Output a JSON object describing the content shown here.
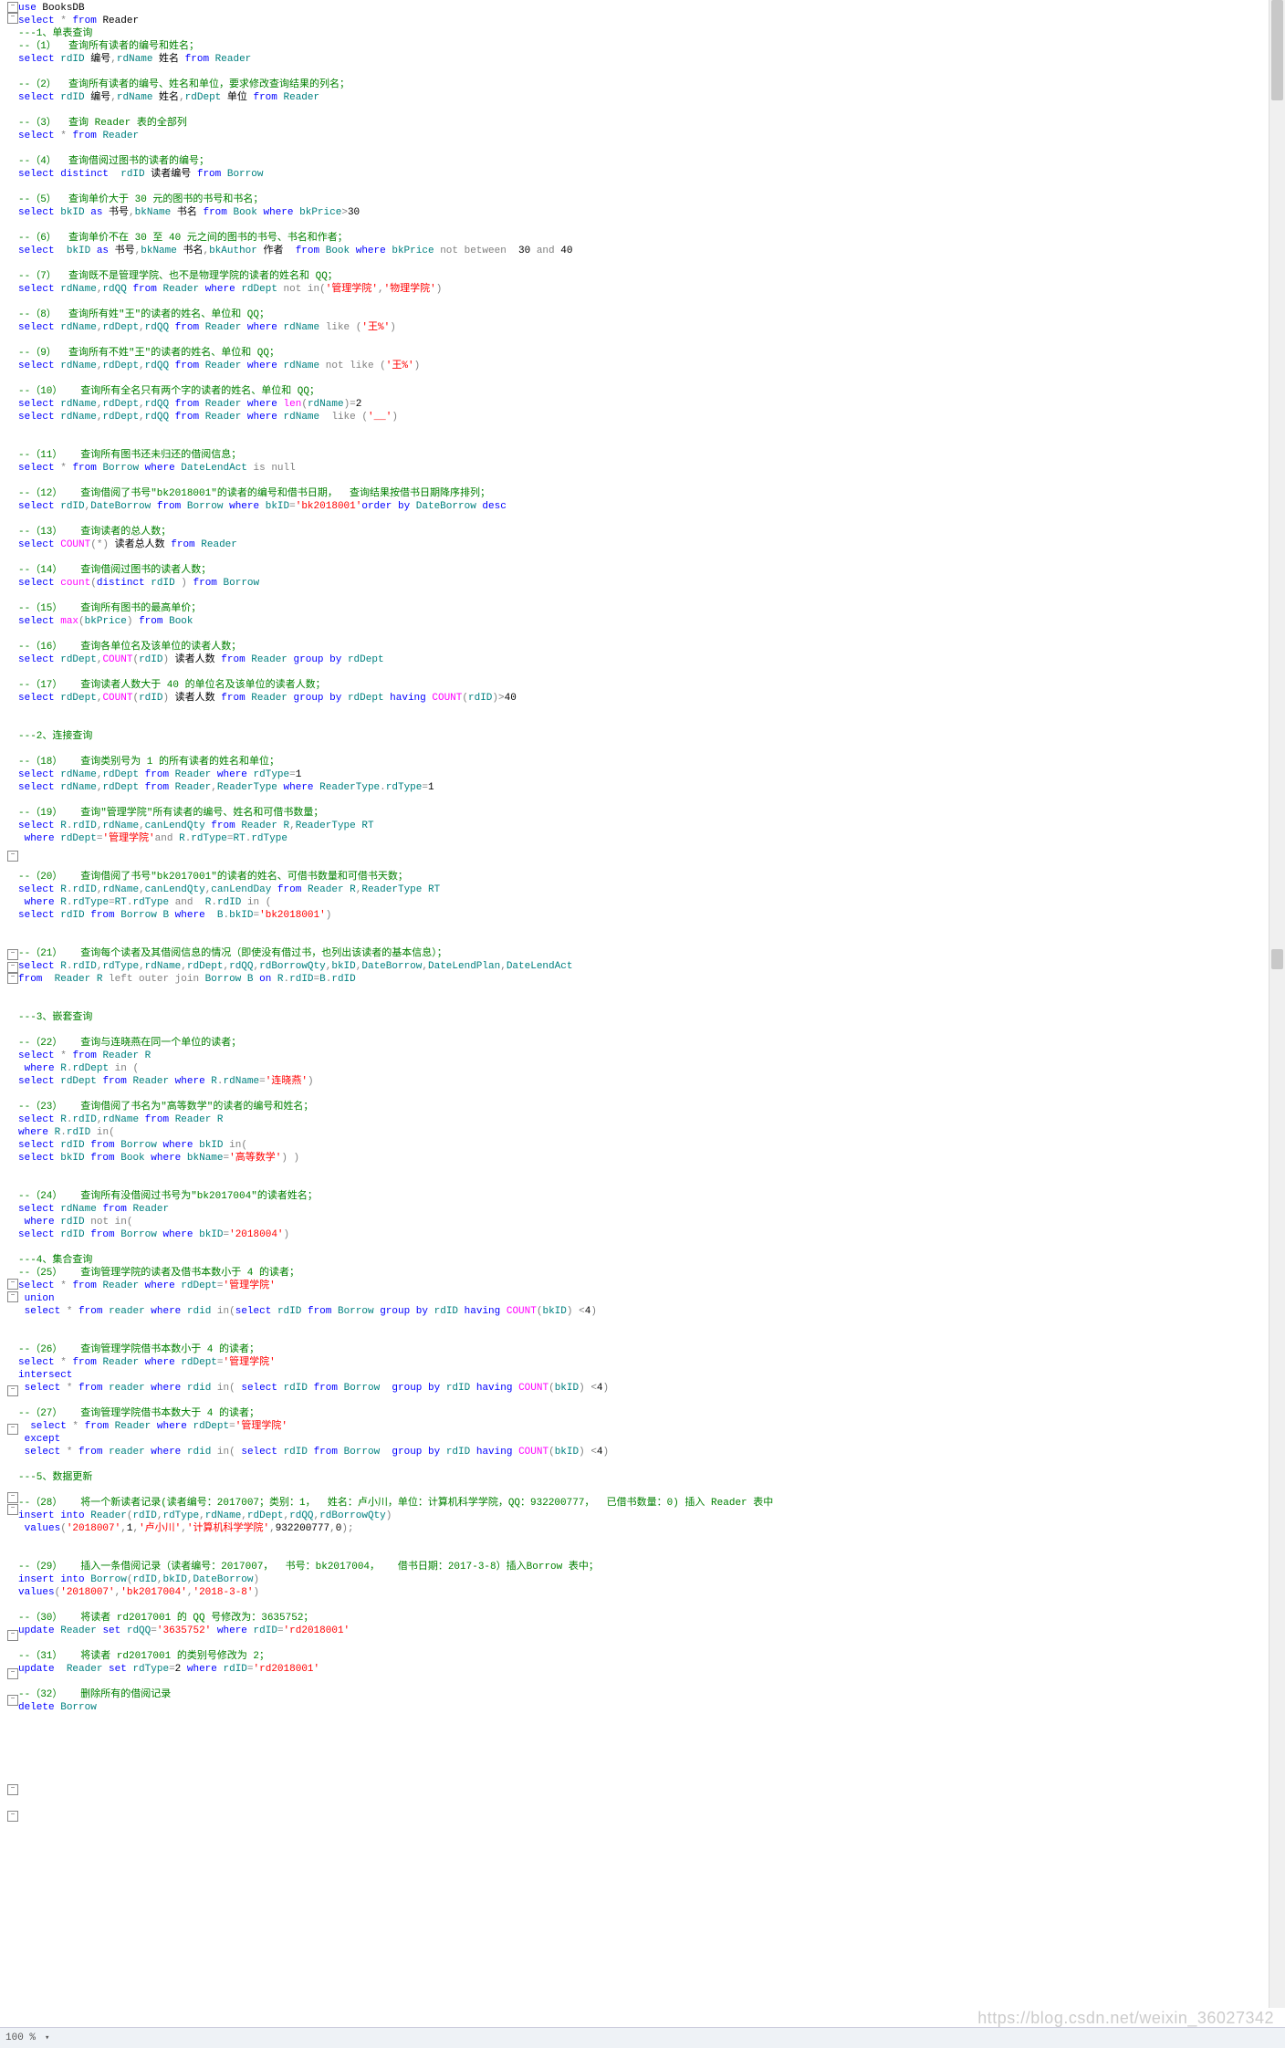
{
  "status": {
    "zoom": "100 %",
    "dd": "▾"
  },
  "watermark": "https://blog.csdn.net/weixin_36027342",
  "folds": [
    2,
    14,
    932,
    1040,
    1054,
    1066,
    1401,
    1415,
    1518,
    1560,
    1635,
    1648,
    1786,
    1828,
    1857,
    1955,
    1984
  ],
  "lines": [
    "<span class='kw'>use</span> BooksDB",
    "<span class='kw'>select</span> <span class='op'>*</span> <span class='kw'>from</span> Reader",
    "<span class='cm'>---1、单表查询</span>",
    "<span class='cm'>--（1）  查询所有读者的编号和姓名；</span>",
    "<span class='kw'>select</span> <span class='id'>rdID</span> 编号<span class='op'>,</span><span class='id'>rdName</span> 姓名 <span class='kw'>from</span> <span class='id'>Reader</span>",
    "",
    "<span class='cm'>--（2）  查询所有读者的编号、姓名和单位，要求修改查询结果的列名；</span>",
    "<span class='kw'>select</span> <span class='id'>rdID</span> 编号<span class='op'>,</span><span class='id'>rdName</span> 姓名<span class='op'>,</span><span class='id'>rdDept</span> 单位 <span class='kw'>from</span> <span class='id'>Reader</span>",
    "",
    "<span class='cm'>--（3）  查询 Reader 表的全部列</span>",
    "<span class='kw'>select</span> <span class='op'>*</span> <span class='kw'>from</span> <span class='id'>Reader</span>",
    "",
    "<span class='cm'>--（4）  查询借阅过图书的读者的编号；</span>",
    "<span class='kw'>select</span> <span class='kw'>distinct</span>  <span class='id'>rdID</span> 读者编号 <span class='kw'>from</span> <span class='id'>Borrow</span>",
    "",
    "<span class='cm'>--（5）  查询单价大于 30 元的图书的书号和书名；</span>",
    "<span class='kw'>select</span> <span class='id'>bkID</span> <span class='kw'>as</span> 书号<span class='op'>,</span><span class='id'>bkName</span> 书名 <span class='kw'>from</span> <span class='id'>Book</span> <span class='kw'>where</span> <span class='id'>bkPrice</span><span class='op'>&gt;</span>30",
    "",
    "<span class='cm'>--（6）  查询单价不在 30 至 40 元之间的图书的书号、书名和作者；</span>",
    "<span class='kw'>select</span>  <span class='id'>bkID</span> <span class='kw'>as</span> 书号<span class='op'>,</span><span class='id'>bkName</span> 书名<span class='op'>,</span><span class='id'>bkAuthor</span> 作者  <span class='kw'>from</span> <span class='id'>Book</span> <span class='kw'>where</span> <span class='id'>bkPrice</span> <span class='gy'>not between</span>  30 <span class='gy'>and</span> 40",
    "",
    "<span class='cm'>--（7）  查询既不是管理学院、也不是物理学院的读者的姓名和 QQ；</span>",
    "<span class='kw'>select</span> <span class='id'>rdName</span><span class='op'>,</span><span class='id'>rdQQ</span> <span class='kw'>from</span> <span class='id'>Reader</span> <span class='kw'>where</span> <span class='id'>rdDept</span> <span class='gy'>not in</span><span class='op'>(</span><span class='str'>'管理学院'</span><span class='op'>,</span><span class='str'>'物理学院'</span><span class='op'>)</span>",
    "",
    "<span class='cm'>--（8）  查询所有姓\"王\"的读者的姓名、单位和 QQ；</span>",
    "<span class='kw'>select</span> <span class='id'>rdName</span><span class='op'>,</span><span class='id'>rdDept</span><span class='op'>,</span><span class='id'>rdQQ</span> <span class='kw'>from</span> <span class='id'>Reader</span> <span class='kw'>where</span> <span class='id'>rdName</span> <span class='gy'>like</span> <span class='op'>(</span><span class='str'>'王%'</span><span class='op'>)</span>",
    "",
    "<span class='cm'>--（9）  查询所有不姓\"王\"的读者的姓名、单位和 QQ；</span>",
    "<span class='kw'>select</span> <span class='id'>rdName</span><span class='op'>,</span><span class='id'>rdDept</span><span class='op'>,</span><span class='id'>rdQQ</span> <span class='kw'>from</span> <span class='id'>Reader</span> <span class='kw'>where</span> <span class='id'>rdName</span> <span class='gy'>not like</span> <span class='op'>(</span><span class='str'>'王%'</span><span class='op'>)</span>",
    "",
    "<span class='cm'>--（10）   查询所有全名只有两个字的读者的姓名、单位和 QQ；</span>",
    "<span class='kw'>select</span> <span class='id'>rdName</span><span class='op'>,</span><span class='id'>rdDept</span><span class='op'>,</span><span class='id'>rdQQ</span> <span class='kw'>from</span> <span class='id'>Reader</span> <span class='kw'>where</span> <span class='fn'>len</span><span class='op'>(</span><span class='id'>rdName</span><span class='op'>)=</span>2",
    "<span class='kw'>select</span> <span class='id'>rdName</span><span class='op'>,</span><span class='id'>rdDept</span><span class='op'>,</span><span class='id'>rdQQ</span> <span class='kw'>from</span> <span class='id'>Reader</span> <span class='kw'>where</span> <span class='id'>rdName</span>  <span class='gy'>like</span> <span class='op'>(</span><span class='str'>'__'</span><span class='op'>)</span>",
    "",
    "",
    "<span class='cm'>--（11）   查询所有图书还未归还的借阅信息；</span>",
    "<span class='kw'>select</span> <span class='op'>*</span> <span class='kw'>from</span> <span class='id'>Borrow</span> <span class='kw'>where</span> <span class='id'>DateLendAct</span> <span class='gy'>is null</span>",
    "",
    "<span class='cm'>--（12）   查询借阅了书号\"bk2018001\"的读者的编号和借书日期，  查询结果按借书日期降序排列；</span>",
    "<span class='kw'>select</span> <span class='id'>rdID</span><span class='op'>,</span><span class='id'>DateBorrow</span> <span class='kw'>from</span> <span class='id'>Borrow</span> <span class='kw'>where</span> <span class='id'>bkID</span><span class='op'>=</span><span class='str'>'bk2018001'</span><span class='kw'>order by</span> <span class='id'>DateBorrow</span> <span class='kw'>desc</span>",
    "",
    "<span class='cm'>--（13）   查询读者的总人数；</span>",
    "<span class='kw'>select</span> <span class='fn'>COUNT</span><span class='op'>(*)</span> 读者总人数 <span class='kw'>from</span> <span class='id'>Reader</span>",
    "",
    "<span class='cm'>--（14）   查询借阅过图书的读者人数；</span>",
    "<span class='kw'>select</span> <span class='fn'>count</span><span class='op'>(</span><span class='kw'>distinct</span> <span class='id'>rdID</span> <span class='op'>)</span> <span class='kw'>from</span> <span class='id'>Borrow</span>",
    "",
    "<span class='cm'>--（15）   查询所有图书的最高单价；</span>",
    "<span class='kw'>select</span> <span class='fn'>max</span><span class='op'>(</span><span class='id'>bkPrice</span><span class='op'>)</span> <span class='kw'>from</span> <span class='id'>Book</span>",
    "",
    "<span class='cm'>--（16）   查询各单位名及该单位的读者人数；</span>",
    "<span class='kw'>select</span> <span class='id'>rdDept</span><span class='op'>,</span><span class='fn'>COUNT</span><span class='op'>(</span><span class='id'>rdID</span><span class='op'>)</span> 读者人数 <span class='kw'>from</span> <span class='id'>Reader</span> <span class='kw'>group by</span> <span class='id'>rdDept</span>",
    "",
    "<span class='cm'>--（17）   查询读者人数大于 40 的单位名及该单位的读者人数；</span>",
    "<span class='kw'>select</span> <span class='id'>rdDept</span><span class='op'>,</span><span class='fn'>COUNT</span><span class='op'>(</span><span class='id'>rdID</span><span class='op'>)</span> 读者人数 <span class='kw'>from</span> <span class='id'>Reader</span> <span class='kw'>group by</span> <span class='id'>rdDept</span> <span class='kw'>having</span> <span class='fn'>COUNT</span><span class='op'>(</span><span class='id'>rdID</span><span class='op'>)&gt;</span>40",
    "",
    "",
    "<span class='cm'>---2、连接查询</span>",
    "",
    "<span class='cm'>--（18）   查询类别号为 1 的所有读者的姓名和单位；</span>",
    "<span class='kw'>select</span> <span class='id'>rdName</span><span class='op'>,</span><span class='id'>rdDept</span> <span class='kw'>from</span> <span class='id'>Reader</span> <span class='kw'>where</span> <span class='id'>rdType</span><span class='op'>=</span>1",
    "<span class='kw'>select</span> <span class='id'>rdName</span><span class='op'>,</span><span class='id'>rdDept</span> <span class='kw'>from</span> <span class='id'>Reader</span><span class='op'>,</span><span class='id'>ReaderType</span> <span class='kw'>where</span> <span class='id'>ReaderType</span><span class='op'>.</span><span class='id'>rdType</span><span class='op'>=</span>1",
    "",
    "<span class='cm'>--（19）   查询\"管理学院\"所有读者的编号、姓名和可借书数量；</span>",
    "<span class='kw'>select</span> <span class='id'>R</span><span class='op'>.</span><span class='id'>rdID</span><span class='op'>,</span><span class='id'>rdName</span><span class='op'>,</span><span class='id'>canLendQty</span> <span class='kw'>from</span> <span class='id'>Reader R</span><span class='op'>,</span><span class='id'>ReaderType RT</span>",
    " <span class='kw'>where</span> <span class='id'>rdDept</span><span class='op'>=</span><span class='str'>'管理学院'</span><span class='gy'>and</span> <span class='id'>R</span><span class='op'>.</span><span class='id'>rdType</span><span class='op'>=</span><span class='id'>RT</span><span class='op'>.</span><span class='id'>rdType</span>",
    "",
    "",
    "<span class='cm'>--（20）   查询借阅了书号\"bk2017001\"的读者的姓名、可借书数量和可借书天数；</span>",
    "<span class='kw'>select</span> <span class='id'>R</span><span class='op'>.</span><span class='id'>rdID</span><span class='op'>,</span><span class='id'>rdName</span><span class='op'>,</span><span class='id'>canLendQty</span><span class='op'>,</span><span class='id'>canLendDay</span> <span class='kw'>from</span> <span class='id'>Reader R</span><span class='op'>,</span><span class='id'>ReaderType RT</span>",
    " <span class='kw'>where</span> <span class='id'>R</span><span class='op'>.</span><span class='id'>rdType</span><span class='op'>=</span><span class='id'>RT</span><span class='op'>.</span><span class='id'>rdType</span> <span class='gy'>and</span>  <span class='id'>R</span><span class='op'>.</span><span class='id'>rdID</span> <span class='gy'>in</span> <span class='op'>(</span>",
    "<span class='kw'>select</span> <span class='id'>rdID</span> <span class='kw'>from</span> <span class='id'>Borrow B</span> <span class='kw'>where</span>  <span class='id'>B</span><span class='op'>.</span><span class='id'>bkID</span><span class='op'>=</span><span class='str'>'bk2018001'</span><span class='op'>)</span>",
    "",
    "",
    "<span class='cm'>--（21）   查询每个读者及其借阅信息的情况（即使没有借过书，也列出该读者的基本信息）；</span>",
    "<span class='kw'>select</span> <span class='id'>R</span><span class='op'>.</span><span class='id'>rdID</span><span class='op'>,</span><span class='id'>rdType</span><span class='op'>,</span><span class='id'>rdName</span><span class='op'>,</span><span class='id'>rdDept</span><span class='op'>,</span><span class='id'>rdQQ</span><span class='op'>,</span><span class='id'>rdBorrowQty</span><span class='op'>,</span><span class='id'>bkID</span><span class='op'>,</span><span class='id'>DateBorrow</span><span class='op'>,</span><span class='id'>DateLendPlan</span><span class='op'>,</span><span class='id'>DateLendAct</span>",
    "<span class='kw'>from</span>  <span class='id'>Reader R</span> <span class='gy'>left outer join</span> <span class='id'>Borrow B</span> <span class='kw'>on</span> <span class='id'>R</span><span class='op'>.</span><span class='id'>rdID</span><span class='op'>=</span><span class='id'>B</span><span class='op'>.</span><span class='id'>rdID</span>",
    "",
    "",
    "<span class='cm'>---3、嵌套查询</span>",
    "",
    "<span class='cm'>--（22）   查询与连晓燕在同一个单位的读者；</span>",
    "<span class='kw'>select</span> <span class='op'>*</span> <span class='kw'>from</span> <span class='id'>Reader R</span>",
    " <span class='kw'>where</span> <span class='id'>R</span><span class='op'>.</span><span class='id'>rdDept</span> <span class='gy'>in</span> <span class='op'>(</span>",
    "<span class='kw'>select</span> <span class='id'>rdDept</span> <span class='kw'>from</span> <span class='id'>Reader</span> <span class='kw'>where</span> <span class='id'>R</span><span class='op'>.</span><span class='id'>rdName</span><span class='op'>=</span><span class='str'>'连晓燕'</span><span class='op'>)</span>",
    "",
    "<span class='cm'>--（23）   查询借阅了书名为\"高等数学\"的读者的编号和姓名；</span>",
    "<span class='kw'>select</span> <span class='id'>R</span><span class='op'>.</span><span class='id'>rdID</span><span class='op'>,</span><span class='id'>rdName</span> <span class='kw'>from</span> <span class='id'>Reader R</span>",
    "<span class='kw'>where</span> <span class='id'>R</span><span class='op'>.</span><span class='id'>rdID</span> <span class='gy'>in</span><span class='op'>(</span>",
    "<span class='kw'>select</span> <span class='id'>rdID</span> <span class='kw'>from</span> <span class='id'>Borrow</span> <span class='kw'>where</span> <span class='id'>bkID</span> <span class='gy'>in</span><span class='op'>(</span>",
    "<span class='kw'>select</span> <span class='id'>bkID</span> <span class='kw'>from</span> <span class='id'>Book</span> <span class='kw'>where</span> <span class='id'>bkName</span><span class='op'>=</span><span class='str'>'高等数学'</span><span class='op'>) )</span>",
    "",
    "",
    "<span class='cm'>--（24）   查询所有没借阅过书号为\"bk2017004\"的读者姓名；</span>",
    "<span class='kw'>select</span> <span class='id'>rdName</span> <span class='kw'>from</span> <span class='id'>Reader</span>",
    " <span class='kw'>where</span> <span class='id'>rdID</span> <span class='gy'>not in</span><span class='op'>(</span>",
    "<span class='kw'>select</span> <span class='id'>rdID</span> <span class='kw'>from</span> <span class='id'>Borrow</span> <span class='kw'>where</span> <span class='id'>bkID</span><span class='op'>=</span><span class='str'>'2018004'</span><span class='op'>)</span>",
    "",
    "<span class='cm'>---4、集合查询</span>",
    "<span class='cm'>--（25）   查询管理学院的读者及借书本数小于 4 的读者；</span>",
    "<span class='kw'>select</span> <span class='op'>*</span> <span class='kw'>from</span> <span class='id'>Reader</span> <span class='kw'>where</span> <span class='id'>rdDept</span><span class='op'>=</span><span class='str'>'管理学院'</span>",
    " <span class='kw'>union</span>",
    " <span class='kw'>select</span> <span class='op'>*</span> <span class='kw'>from</span> <span class='id'>reader</span> <span class='kw'>where</span> <span class='id'>rdid</span> <span class='gy'>in</span><span class='op'>(</span><span class='kw'>select</span> <span class='id'>rdID</span> <span class='kw'>from</span> <span class='id'>Borrow</span> <span class='kw'>group by</span> <span class='id'>rdID</span> <span class='kw'>having</span> <span class='fn'>COUNT</span><span class='op'>(</span><span class='id'>bkID</span><span class='op'>)</span> <span class='op'>&lt;</span>4<span class='op'>)</span>",
    "",
    "",
    "<span class='cm'>--（26）   查询管理学院借书本数小于 4 的读者；</span>",
    "<span class='kw'>select</span> <span class='op'>*</span> <span class='kw'>from</span> <span class='id'>Reader</span> <span class='kw'>where</span> <span class='id'>rdDept</span><span class='op'>=</span><span class='str'>'管理学院'</span>",
    "<span class='kw'>intersect</span>",
    " <span class='kw'>select</span> <span class='op'>*</span> <span class='kw'>from</span> <span class='id'>reader</span> <span class='kw'>where</span> <span class='id'>rdid</span> <span class='gy'>in</span><span class='op'>(</span> <span class='kw'>select</span> <span class='id'>rdID</span> <span class='kw'>from</span> <span class='id'>Borrow</span>  <span class='kw'>group by</span> <span class='id'>rdID</span> <span class='kw'>having</span> <span class='fn'>COUNT</span><span class='op'>(</span><span class='id'>bkID</span><span class='op'>)</span> <span class='op'>&lt;</span>4<span class='op'>)</span>",
    "",
    "<span class='cm'>--（27）   查询管理学院借书本数大于 4 的读者；</span>",
    "  <span class='kw'>select</span> <span class='op'>*</span> <span class='kw'>from</span> <span class='id'>Reader</span> <span class='kw'>where</span> <span class='id'>rdDept</span><span class='op'>=</span><span class='str'>'管理学院'</span>",
    " <span class='kw'>except</span>",
    " <span class='kw'>select</span> <span class='op'>*</span> <span class='kw'>from</span> <span class='id'>reader</span> <span class='kw'>where</span> <span class='id'>rdid</span> <span class='gy'>in</span><span class='op'>(</span> <span class='kw'>select</span> <span class='id'>rdID</span> <span class='kw'>from</span> <span class='id'>Borrow</span>  <span class='kw'>group by</span> <span class='id'>rdID</span> <span class='kw'>having</span> <span class='fn'>COUNT</span><span class='op'>(</span><span class='id'>bkID</span><span class='op'>)</span> <span class='op'>&lt;</span>4<span class='op'>)</span>",
    "",
    "<span class='cm'>---5、数据更新</span>",
    "",
    "<span class='cm'>--（28）   将一个新读者记录(读者编号：2017007；类别：1，  姓名：卢小川，单位：计算机科学学院，QQ：932200777，  已借书数量：0) 插入 Reader 表中</span>",
    "<span class='kw'>insert into</span> <span class='id'>Reader</span><span class='op'>(</span><span class='id'>rdID</span><span class='op'>,</span><span class='id'>rdType</span><span class='op'>,</span><span class='id'>rdName</span><span class='op'>,</span><span class='id'>rdDept</span><span class='op'>,</span><span class='id'>rdQQ</span><span class='op'>,</span><span class='id'>rdBorrowQty</span><span class='op'>)</span>",
    " <span class='kw'>values</span><span class='op'>(</span><span class='str'>'2018007'</span><span class='op'>,</span>1<span class='op'>,</span><span class='str'>'卢小川'</span><span class='op'>,</span><span class='str'>'计算机科学学院'</span><span class='op'>,</span>932200777<span class='op'>,</span>0<span class='op'>)</span><span class='op'>;</span>",
    "",
    "",
    "<span class='cm'>--（29）   插入一条借阅记录（读者编号：2017007，  书号：bk2017004，   借书日期：2017-3-8）插入Borrow 表中；</span>",
    "<span class='kw'>insert into</span> <span class='id'>Borrow</span><span class='op'>(</span><span class='id'>rdID</span><span class='op'>,</span><span class='id'>bkID</span><span class='op'>,</span><span class='id'>DateBorrow</span><span class='op'>)</span>",
    "<span class='kw'>values</span><span class='op'>(</span><span class='str'>'2018007'</span><span class='op'>,</span><span class='str'>'bk2017004'</span><span class='op'>,</span><span class='str'>'2018-3-8'</span><span class='op'>)</span>",
    "",
    "<span class='cm'>--（30）   将读者 rd2017001 的 QQ 号修改为：3635752；</span>",
    "<span class='kw'>update</span> <span class='id'>Reader</span> <span class='kw'>set</span> <span class='id'>rdQQ</span><span class='op'>=</span><span class='str'>'3635752'</span> <span class='kw'>where</span> <span class='id'>rdID</span><span class='op'>=</span><span class='str'>'rd2018001'</span>",
    "",
    "<span class='cm'>--（31）   将读者 rd2017001 的类别号修改为 2；</span>",
    "<span class='kw'>update</span>  <span class='id'>Reader</span> <span class='kw'>set</span> <span class='id'>rdType</span><span class='op'>=</span>2 <span class='kw'>where</span> <span class='id'>rdID</span><span class='op'>=</span><span class='str'>'rd2018001'</span>",
    "",
    "<span class='cm'>--（32）   删除所有的借阅记录</span>",
    "<span class='kw'>delete</span> <span class='id'>Borrow</span>"
  ]
}
